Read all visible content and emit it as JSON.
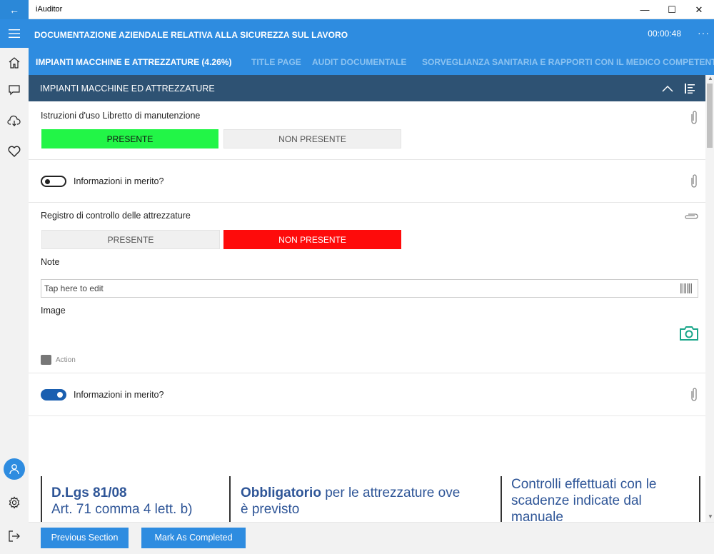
{
  "window": {
    "title": "iAuditor",
    "minimize_glyph": "—",
    "maximize_glyph": "☐",
    "close_glyph": "✕",
    "back_glyph": "←"
  },
  "header": {
    "document_title": "DOCUMENTAZIONE AZIENDALE RELATIVA ALLA SICUREZZA SUL LAVORO",
    "timer": "00:00:48",
    "more_glyph": "···"
  },
  "tabs": [
    {
      "label": "IMPIANTI MACCHINE E ATTREZZATURE (4.26%)",
      "active": true
    },
    {
      "label": "TITLE PAGE",
      "active": false
    },
    {
      "label": "AUDIT DOCUMENTALE",
      "active": false
    },
    {
      "label": "SORVEGLIANZA SANITARIA E RAPPORTI CON IL MEDICO COMPETENTE",
      "active": false
    }
  ],
  "section": {
    "title": "IMPIANTI MACCHINE ED ATTREZZATURE",
    "collapse_icon": "chevron-up-icon",
    "list_icon": "list-icon"
  },
  "questions": [
    {
      "label": "Istruzioni d'uso Libretto di manutenzione",
      "options": [
        "PRESENTE",
        "NON PRESENTE"
      ],
      "selected": "PRESENTE"
    },
    {
      "label": "Registro di controllo delle attrezzature",
      "options": [
        "PRESENTE",
        "NON PRESENTE"
      ],
      "selected": "NON PRESENTE"
    }
  ],
  "toggles": [
    {
      "label": "Informazioni in merito?",
      "state": "off"
    },
    {
      "label": "Informazioni in merito?",
      "state": "on"
    }
  ],
  "note": {
    "label": "Note",
    "placeholder": "Tap here to edit"
  },
  "image": {
    "label": "Image"
  },
  "action": {
    "label": "Action"
  },
  "info": {
    "col1_bold": "D.Lgs 81/08",
    "col1_text": "Art. 71 comma 4 lett. b)",
    "col2_bold": "Obbligatorio",
    "col2_text_a": " per le attrezzature ove",
    "col2_text_b": "è previsto",
    "col3_line1": "Controlli effettuati con le",
    "col3_line2": "scadenze indicate dal",
    "col3_line3": "manuale"
  },
  "footer": {
    "previous_label": "Previous Section",
    "complete_label": "Mark As Completed"
  },
  "colors": {
    "accent": "#2e8ce0",
    "section_bar": "#2e5273",
    "selected_positive": "#22f547",
    "selected_negative": "#fe0b0b",
    "toggle_on": "#1a5fb0",
    "camera": "#1aa68a",
    "info_text": "#2e5597"
  }
}
